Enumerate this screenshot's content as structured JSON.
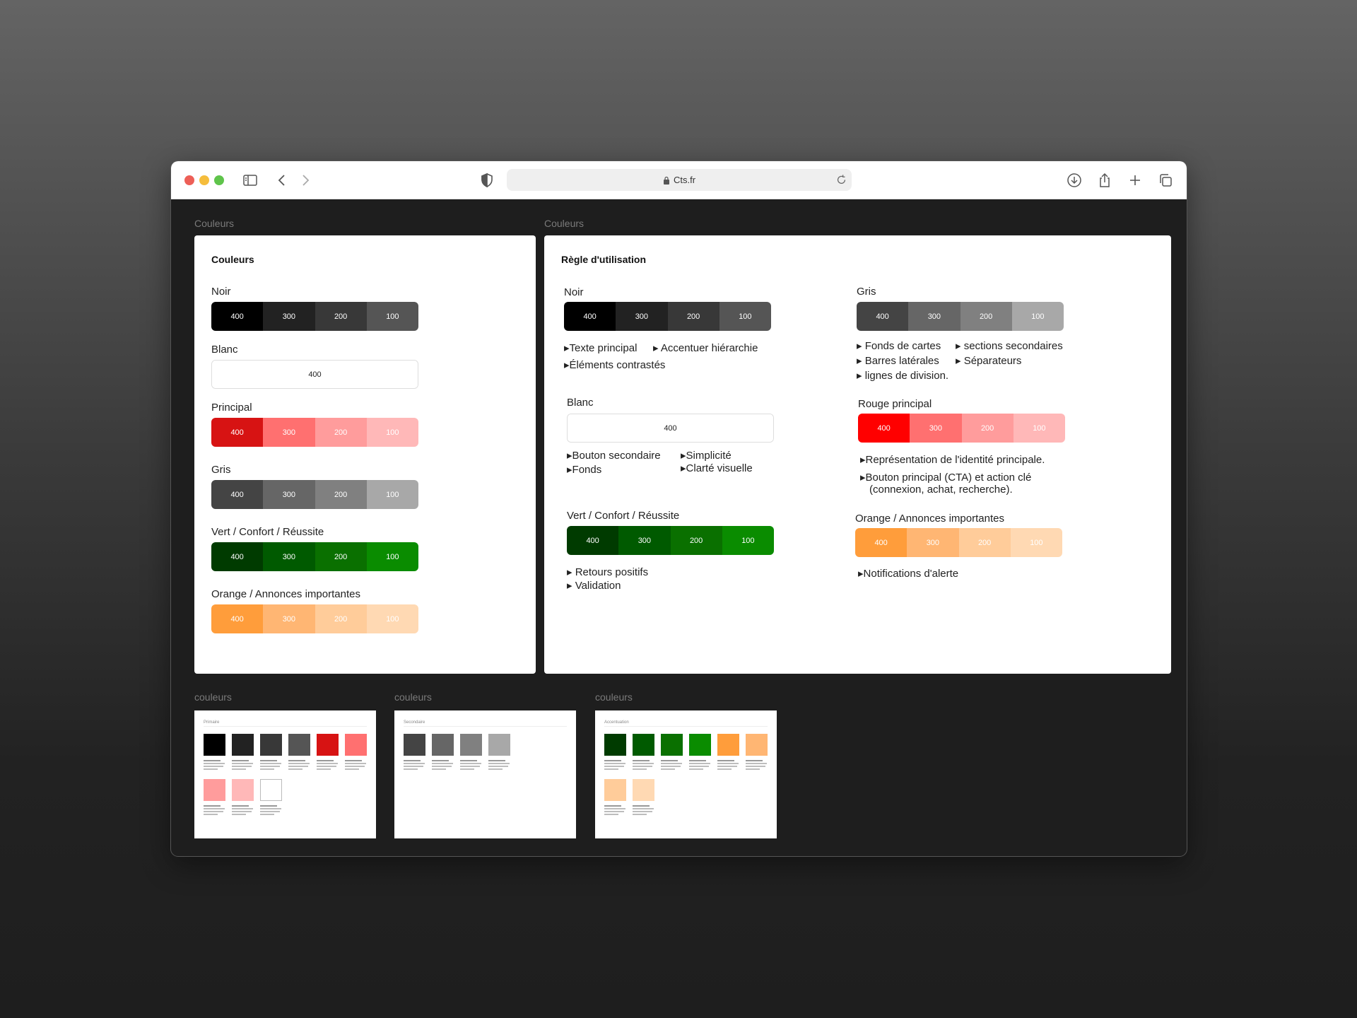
{
  "browser": {
    "url": "Cts.fr"
  },
  "left_frame": {
    "label": "Couleurs",
    "title": "Couleurs",
    "groups": [
      {
        "label": "Noir",
        "swatches": [
          {
            "level": "400",
            "color": "#000000",
            "text_color": "#ffffff"
          },
          {
            "level": "300",
            "color": "#222222",
            "text_color": "#ffffff"
          },
          {
            "level": "200",
            "color": "#383838",
            "text_color": "#ffffff"
          },
          {
            "level": "100",
            "color": "#555555",
            "text_color": "#ffffff"
          }
        ]
      },
      {
        "label": "Blanc",
        "swatches": [
          {
            "level": "400",
            "color": "#ffffff",
            "text_color": "#222222"
          }
        ]
      },
      {
        "label": "Principal",
        "swatches": [
          {
            "level": "400",
            "color": "#d71313",
            "text_color": "#ffffff"
          },
          {
            "level": "300",
            "color": "#ff7070",
            "text_color": "#ffffff"
          },
          {
            "level": "200",
            "color": "#ff9c9c",
            "text_color": "#ffffff"
          },
          {
            "level": "100",
            "color": "#ffb8b8",
            "text_color": "#ffffff"
          }
        ]
      },
      {
        "label": "Gris",
        "swatches": [
          {
            "level": "400",
            "color": "#444444",
            "text_color": "#ffffff"
          },
          {
            "level": "300",
            "color": "#666666",
            "text_color": "#ffffff"
          },
          {
            "level": "200",
            "color": "#808080",
            "text_color": "#ffffff"
          },
          {
            "level": "100",
            "color": "#a8a8a8",
            "text_color": "#ffffff"
          }
        ]
      },
      {
        "label": "Vert / Confort / Réussite",
        "swatches": [
          {
            "level": "400",
            "color": "#003b00",
            "text_color": "#ffffff"
          },
          {
            "level": "300",
            "color": "#005a00",
            "text_color": "#ffffff"
          },
          {
            "level": "200",
            "color": "#0a7000",
            "text_color": "#ffffff"
          },
          {
            "level": "100",
            "color": "#0a8c00",
            "text_color": "#ffffff"
          }
        ]
      },
      {
        "label": "Orange / Annonces importantes",
        "swatches": [
          {
            "level": "400",
            "color": "#ff9d3b",
            "text_color": "#ffffff"
          },
          {
            "level": "300",
            "color": "#ffb673",
            "text_color": "#ffffff"
          },
          {
            "level": "200",
            "color": "#ffcc9a",
            "text_color": "#ffffff"
          },
          {
            "level": "100",
            "color": "#ffd9b3",
            "text_color": "#ffffff"
          }
        ]
      }
    ]
  },
  "right_frame": {
    "label": "Couleurs",
    "title": "Règle d'utilisation",
    "groups": [
      {
        "label": "Noir",
        "swatches": [
          {
            "level": "400",
            "color": "#000000",
            "text_color": "#ffffff"
          },
          {
            "level": "300",
            "color": "#222222",
            "text_color": "#ffffff"
          },
          {
            "level": "200",
            "color": "#383838",
            "text_color": "#ffffff"
          },
          {
            "level": "100",
            "color": "#555555",
            "text_color": "#ffffff"
          }
        ],
        "bullets": [
          "▸Texte principal",
          "▸ Accentuer hiérarchie",
          "▸Éléments contrastés"
        ]
      },
      {
        "label": "Blanc",
        "swatches": [
          {
            "level": "400",
            "color": "#ffffff",
            "text_color": "#222222"
          }
        ],
        "bullets": [
          "▸Bouton secondaire",
          "▸Fonds",
          "▸Simplicité",
          "▸Clarté visuelle"
        ]
      },
      {
        "label": "Vert / Confort / Réussite",
        "swatches": [
          {
            "level": "400",
            "color": "#003b00",
            "text_color": "#ffffff"
          },
          {
            "level": "300",
            "color": "#005a00",
            "text_color": "#ffffff"
          },
          {
            "level": "200",
            "color": "#0a7000",
            "text_color": "#ffffff"
          },
          {
            "level": "100",
            "color": "#0a8c00",
            "text_color": "#ffffff"
          }
        ],
        "bullets": [
          "▸ Retours positifs",
          "▸ Validation"
        ]
      },
      {
        "label": "Gris",
        "swatches": [
          {
            "level": "400",
            "color": "#444444",
            "text_color": "#ffffff"
          },
          {
            "level": "300",
            "color": "#666666",
            "text_color": "#ffffff"
          },
          {
            "level": "200",
            "color": "#808080",
            "text_color": "#ffffff"
          },
          {
            "level": "100",
            "color": "#a8a8a8",
            "text_color": "#ffffff"
          }
        ],
        "bullets": [
          "▸ Fonds de cartes",
          "▸ sections secondaires",
          "▸ Barres latérales",
          "▸ Séparateurs",
          "▸ lignes de division."
        ]
      },
      {
        "label": "Rouge principal",
        "swatches": [
          {
            "level": "400",
            "color": "#ff0000",
            "text_color": "#ffffff"
          },
          {
            "level": "300",
            "color": "#ff7070",
            "text_color": "#ffffff"
          },
          {
            "level": "200",
            "color": "#ff9c9c",
            "text_color": "#ffffff"
          },
          {
            "level": "100",
            "color": "#ffb8b8",
            "text_color": "#ffffff"
          }
        ],
        "bullets": [
          "▸Représentation de l'identité principale.",
          "▸Bouton principal (CTA) et action clé",
          "(connexion, achat, recherche)."
        ]
      },
      {
        "label": "Orange / Annonces importantes",
        "swatches": [
          {
            "level": "400",
            "color": "#ff9d3b",
            "text_color": "#ffffff"
          },
          {
            "level": "300",
            "color": "#ffb673",
            "text_color": "#ffffff"
          },
          {
            "level": "200",
            "color": "#ffcc9a",
            "text_color": "#ffffff"
          },
          {
            "level": "100",
            "color": "#ffd9b3",
            "text_color": "#ffffff"
          }
        ],
        "bullets": [
          "▸Notifications d'alerte"
        ]
      }
    ]
  },
  "thumbnails": [
    {
      "label": "couleurs",
      "title": "Primaire",
      "swatches": [
        {
          "color": "#000000"
        },
        {
          "color": "#222222"
        },
        {
          "color": "#383838"
        },
        {
          "color": "#555555"
        },
        {
          "color": "#d71313"
        },
        {
          "color": "#ff7070"
        },
        {
          "color": "#ff9c9c"
        },
        {
          "color": "#ffb8b8"
        },
        {
          "color": "#ffffff",
          "bordered": true
        }
      ]
    },
    {
      "label": "couleurs",
      "title": "Secondaire",
      "swatches": [
        {
          "color": "#444444"
        },
        {
          "color": "#666666"
        },
        {
          "color": "#808080"
        },
        {
          "color": "#a8a8a8"
        }
      ]
    },
    {
      "label": "couleurs",
      "title": "Accentuation",
      "swatches": [
        {
          "color": "#003b00"
        },
        {
          "color": "#005a00"
        },
        {
          "color": "#0a7000"
        },
        {
          "color": "#0a8c00"
        },
        {
          "color": "#ff9d3b"
        },
        {
          "color": "#ffb673"
        },
        {
          "color": "#ffcc9a"
        },
        {
          "color": "#ffd9b3"
        }
      ]
    }
  ]
}
